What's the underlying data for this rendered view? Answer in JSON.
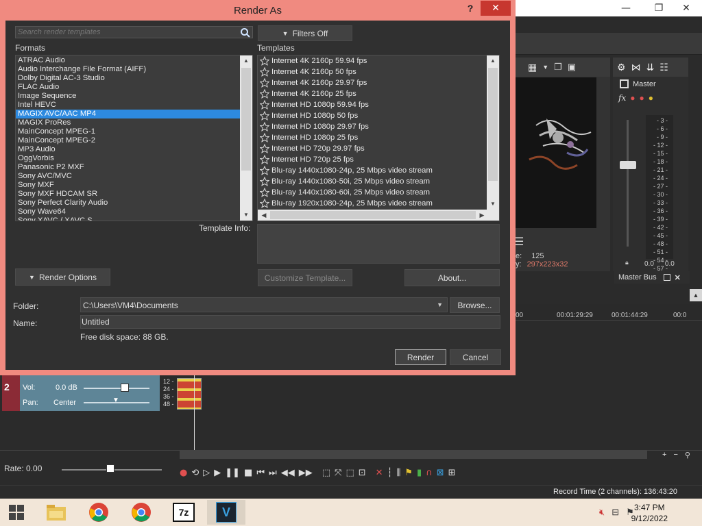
{
  "dialog": {
    "title": "Render As",
    "help_label": "?",
    "close_label": "✕",
    "search": {
      "placeholder": "Search render templates"
    },
    "filters_label": "Filters Off",
    "formats_label": "Formats",
    "templates_label": "Templates",
    "formats": [
      "ATRAC Audio",
      "Audio Interchange File Format (AIFF)",
      "Dolby Digital AC-3 Studio",
      "FLAC Audio",
      "Image Sequence",
      "Intel HEVC",
      "MAGIX AVC/AAC MP4",
      "MAGIX ProRes",
      "MainConcept MPEG-1",
      "MainConcept MPEG-2",
      "MP3 Audio",
      "OggVorbis",
      "Panasonic P2 MXF",
      "Sony AVC/MVC",
      "Sony MXF",
      "Sony MXF HDCAM SR",
      "Sony Perfect Clarity Audio",
      "Sony Wave64",
      "Sony XAVC / XAVC S"
    ],
    "selected_format": "MAGIX AVC/AAC MP4",
    "templates": [
      "Internet 4K 2160p 59.94 fps",
      "Internet 4K 2160p 50 fps",
      "Internet 4K 2160p 29.97 fps",
      "Internet 4K 2160p 25 fps",
      "Internet HD 1080p 59.94 fps",
      "Internet HD 1080p 50 fps",
      "Internet HD 1080p 29.97 fps",
      "Internet HD 1080p 25 fps",
      "Internet HD 720p 29.97 fps",
      "Internet HD 720p 25 fps",
      "Blu-ray 1440x1080-24p, 25 Mbps video stream",
      "Blu-ray 1440x1080-50i, 25 Mbps video stream",
      "Blu-ray 1440x1080-60i, 25 Mbps video stream",
      "Blu-ray 1920x1080-24p, 25 Mbps video stream"
    ],
    "template_info_label": "Template Info:",
    "template_info": "",
    "render_options_label": "Render Options",
    "customize_label": "Customize Template...",
    "about_label": "About...",
    "folder_label": "Folder:",
    "folder_value": "C:\\Users\\VM4\\Documents",
    "browse_label": "Browse...",
    "name_label": "Name:",
    "name_value": "Untitled",
    "free_disk": "Free disk space: 88 GB.",
    "render_label": "Render",
    "cancel_label": "Cancel"
  },
  "background_app": {
    "winctl": {
      "minimize": "—",
      "restore": "❐",
      "close": "✕"
    },
    "preview": {
      "frame_label": "e:",
      "frame_value": "125",
      "display_label": "y:",
      "display_value": "297x223x32"
    },
    "mixer": {
      "master_label": "Master",
      "meter_scale": [
        "3",
        "6",
        "9",
        "12",
        "15",
        "18",
        "21",
        "24",
        "27",
        "30",
        "33",
        "36",
        "39",
        "42",
        "45",
        "48",
        "51",
        "54",
        "57"
      ],
      "left_level": "0.0",
      "right_level": "0.0",
      "master_bus_label": "Master Bus"
    },
    "timeline": {
      "ruler_left": "00",
      "ruler_mid1": "00:01:29:29",
      "ruler_mid2": "00:01:44:29",
      "ruler_right": "00:0"
    },
    "track": {
      "number": "2",
      "vol_label": "Vol:",
      "vol_value": "0.0 dB",
      "pan_label": "Pan:",
      "pan_value": "Center",
      "level_ticks": [
        "12",
        "24",
        "36",
        "48"
      ]
    },
    "rate_label": "Rate: 0.00",
    "record_time": "Record Time (2 channels): 136:43:20"
  },
  "taskbar": {
    "apps": [
      "windows-start",
      "file-explorer",
      "chrome",
      "chrome",
      "7-zip",
      "vegas"
    ],
    "sevenzip_label": "7z",
    "vegas_label": "V",
    "time": "3:47 PM",
    "date": "9/12/2022"
  },
  "colors": {
    "dialog_border": "#f08a80",
    "dialog_bg": "#303030",
    "selection": "#2d8ae0",
    "close_red": "#c7372f",
    "taskbar": "#f2e6d8"
  }
}
